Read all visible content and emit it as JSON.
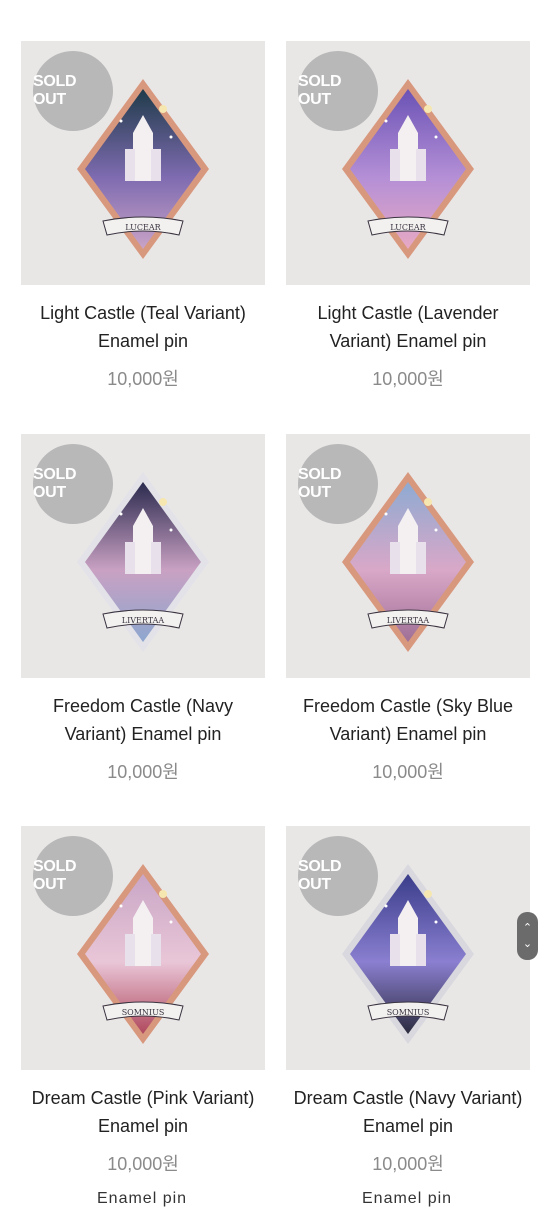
{
  "products": [
    {
      "title": "Light Castle (Teal Variant) Enamel pin",
      "price": "10,000원",
      "badge": "SOLD OUT",
      "colors": {
        "sky": "#1f3b4a",
        "mid": "#7e6bb0",
        "low": "#c9a3c7",
        "frame": "#d8987d"
      }
    },
    {
      "title": "Light Castle (Lavender Variant) Enamel pin",
      "price": "10,000원",
      "badge": "SOLD OUT",
      "colors": {
        "sky": "#6a52b5",
        "mid": "#b48fd6",
        "low": "#e7a9c4",
        "frame": "#d8987d"
      }
    },
    {
      "title": "Freedom Castle (Navy Variant) Enamel pin",
      "price": "10,000원",
      "badge": "SOLD OUT",
      "colors": {
        "sky": "#2a2a4e",
        "mid": "#c9a1c3",
        "low": "#8da6cf",
        "frame": "#e2e2e8"
      }
    },
    {
      "title": "Freedom Castle (Sky Blue Variant) Enamel pin",
      "price": "10,000원",
      "badge": "SOLD OUT",
      "colors": {
        "sky": "#8eaad2",
        "mid": "#d9a8c8",
        "low": "#a06f96",
        "frame": "#d8987d"
      }
    },
    {
      "title": "Dream Castle (Pink Variant) Enamel pin",
      "price": "10,000원",
      "badge": "SOLD OUT",
      "colors": {
        "sky": "#c9a6c6",
        "mid": "#e9c6d7",
        "low": "#b0485e",
        "frame": "#d8987d"
      }
    },
    {
      "title": "Dream Castle (Navy Variant) Enamel pin",
      "price": "10,000원",
      "badge": "SOLD OUT",
      "colors": {
        "sky": "#3a3d8a",
        "mid": "#8a7fd0",
        "low": "#2b2b3f",
        "frame": "#d8d8de"
      }
    }
  ],
  "pin_labels": [
    "LUCEAR",
    "LUCEAR",
    "LIVERTAA",
    "LIVERTAA",
    "SOMNIUS",
    "SOMNIUS"
  ],
  "scroll": {
    "up_icon": "chevron-up",
    "down_icon": "chevron-down"
  },
  "cut_off_text": "Enamel pin"
}
